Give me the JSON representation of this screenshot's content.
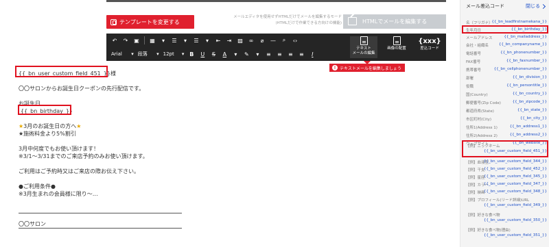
{
  "toolbar_top": {
    "template_button": "テンプレートを変更する",
    "mode_note_line1": "メールエディタを使用せずHTMLだけでメールを編集するモード",
    "mode_note_line2": "(HTMLだけで作業できる方向けの機能)",
    "html_button": "HTMLでメールを編集する"
  },
  "editor_toolbar": {
    "font_family": "Arial",
    "paragraph": "段落",
    "font_size": "12pt",
    "text_mail_edit": [
      "テキスト",
      "メールの編集"
    ],
    "image_placement": "画像の配置",
    "insert_code": "差込コード",
    "insert_code_glyph": "{xxx}",
    "warning": "テキストメールを編集しましょう"
  },
  "email_body": {
    "greeting": "{{_bn_user_custom_field_451_}}様",
    "line1": "〇〇サロンからお誕生日クーポンの先行配信です。",
    "birthday_label": "お誕生日",
    "birthday_code": "{{_bn_birthday_}}",
    "offer_title": "3月のお誕生日の方へ",
    "offer_detail": "★施術料金より5%割引",
    "usage1": "3月中何度でもお使い頂けます！",
    "usage2": "※3/1〜3/31までのご来店予約のみお使い頂けます。",
    "instruction": "ご利用はご予約時又はご来店の際お伝え下さい。",
    "conditions_title": "●ご利用条件●",
    "conditions_detail": "※3月生まれの会員様に限り〜…",
    "signature": "〇〇サロン"
  },
  "sidebar": {
    "title": "メール差込コード",
    "close": "閉じる",
    "items": [
      {
        "label": "名（フリガナ）",
        "code": "{{_bn_leadfirstnamekana_}}"
      },
      {
        "label": "生年月日",
        "code": "{{_bn_birthday_}}"
      },
      {
        "label": "メールアドレス",
        "code": "{{_bn_mailaddress_}}"
      },
      {
        "label": "会社・組織名",
        "code": "{{_bn_companyname_}}"
      },
      {
        "label": "電話番号",
        "code": "{{_bn_phonenumber_}}"
      },
      {
        "label": "FAX番号",
        "code": "{{_bn_faxnumber_}}"
      },
      {
        "label": "携帯番号",
        "code": "{{_bn_cellphonenumber_}}"
      },
      {
        "label": "部署",
        "code": "{{_bn_division_}}"
      },
      {
        "label": "役職",
        "code": "{{_bn_persontitle_}}"
      },
      {
        "label": "国(Country)",
        "code": "{{_bn_country_}}"
      },
      {
        "label": "郵便番号(Zip Code)",
        "code": "{{_bn_zipcode_}}"
      },
      {
        "label": "都道府県(State)",
        "code": "{{_bn_state_}}"
      },
      {
        "label": "市区町村(City)",
        "code": "{{_bn_city_}}"
      },
      {
        "label": "住所1(Address 1)",
        "code": "{{_bn_address1_}}"
      },
      {
        "label": "住所2(Address 2)",
        "code": "{{_bn_address2_}}"
      },
      {
        "label": "ウェブサイト",
        "code": "{{_bn_website_}}"
      },
      {
        "label": "【例】ニックネーム",
        "code": "{{_bn_user_custom_field_451_}}"
      },
      {
        "label": "【例】血液型",
        "code": "{{_bn_user_custom_field_344_}}"
      },
      {
        "label": "【例】干支",
        "code": "{{_bn_user_custom_field_452_}}"
      },
      {
        "label": "【例】星座",
        "code": "{{_bn_user_custom_field_345_}}"
      },
      {
        "label": "【例】カラー",
        "code": "{{_bn_user_custom_field_347_}}"
      },
      {
        "label": "【例】映画",
        "code": "{{_bn_user_custom_field_348_}}"
      },
      {
        "label": "【例】プロフィール(リード詳細)URL",
        "code": "{{_bn_user_custom_field_349_}}"
      },
      {
        "label": "【例】好きな食べ物",
        "code": "{{_bn_user_custom_field_350_}}"
      },
      {
        "label": "【例】好きな食べ物(理由)",
        "code": "{{_bn_user_custom_field_351_}}"
      }
    ]
  },
  "colors": {
    "accent_red": "#e0202e",
    "link_blue": "#1e50c8",
    "toolbar_bg": "#252525"
  }
}
